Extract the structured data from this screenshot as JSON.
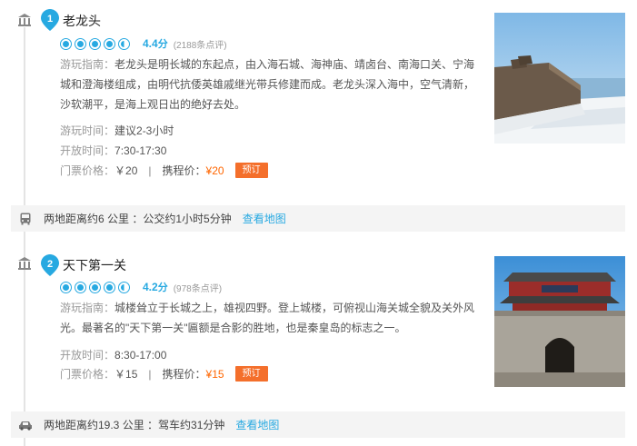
{
  "spots": [
    {
      "index": "1",
      "name": "老龙头",
      "score": "4.4",
      "score_unit": "分",
      "reviews": "(2188条点评)",
      "rating_fraction": 0.88,
      "guide_label": "游玩指南：",
      "guide_text": "老龙头是明长城的东起点，由入海石城、海神庙、靖卤台、南海口关、宁海城和澄海楼组成，由明代抗倭英雄戚继光带兵修建而成。老龙头深入海中，空气清新，沙软潮平，是海上观日出的绝好去处。",
      "duration_label": "游玩时间：",
      "duration": "建议2-3小时",
      "hours_label": "开放时间：",
      "hours": "7:30-17:30",
      "ticket_label": "门票价格：",
      "ticket": "￥20",
      "sep": "|",
      "cheng_label": "携程价：",
      "cheng_price": "¥20",
      "book": "预订"
    },
    {
      "index": "2",
      "name": "天下第一关",
      "score": "4.2",
      "score_unit": "分",
      "reviews": "(978条点评)",
      "rating_fraction": 0.84,
      "guide_label": "游玩指南：",
      "guide_text": "城楼耸立于长城之上，雄视四野。登上城楼，可俯视山海关城全貌及关外风光。最著名的\"天下第一关\"匾额是合影的胜地，也是秦皇岛的标志之一。",
      "hours_label": "开放时间：",
      "hours": "8:30-17:00",
      "ticket_label": "门票价格：",
      "ticket": "￥15",
      "sep": "|",
      "cheng_label": "携程价：",
      "cheng_price": "¥15",
      "book": "预订"
    }
  ],
  "distances": [
    {
      "text": "两地距离约6 公里 ：公交约1小时5分钟",
      "map_link": "查看地图",
      "icon": "bus-icon"
    },
    {
      "text": "两地距离约19.3 公里 ：驾车约31分钟",
      "map_link": "查看地图",
      "icon": "car-icon"
    }
  ],
  "colors": {
    "accent": "#27a9e1",
    "price": "#ff6600",
    "book_button": "#f46f2b"
  }
}
